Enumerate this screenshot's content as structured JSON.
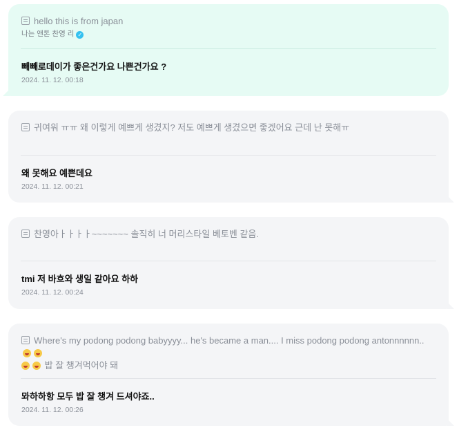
{
  "cards": [
    {
      "question": "hello this is from japan",
      "author": "나는 앤톤 찬영 리",
      "answer": "빼빼로데이가 좋은건가요 나쁜건가요 ?",
      "date": "2024. 11. 12. 00:18"
    },
    {
      "question": "귀여워 ㅠㅠ 왜 이렇게 예쁘게 생겼지? 저도 예쁘게 생겼으면 좋겠어요 근데 난 못해ㅠ",
      "answer": "왜 못해요 예쁜데요",
      "date": "2024. 11. 12. 00:21"
    },
    {
      "question": "찬영아ㅏㅏㅏㅏ~~~~~~~ 솔직히 너 머리스타일 베토벤 같음.",
      "answer": "tmi 저 바흐와 생일 같아요 하하",
      "date": "2024. 11. 12. 00:24"
    },
    {
      "question_line1": "Where's my podong podong babyyyy... he's became a man.... I miss podong podong antonnnnnn..",
      "question_line2": "밥 잘 챙겨먹어야 돼",
      "question_emojis": [
        "weary-face-emoji",
        "crying-face-emoji",
        "crying-face-emoji",
        "crying-face-emoji"
      ],
      "answer": "뫄하하항 모두 밥 잘 챙겨 드셔야죠..",
      "date": "2024. 11. 12. 00:26"
    }
  ],
  "colors": {
    "first_bubble": "#e6fbf4",
    "reply_bubble": "#f4f5f7",
    "verified_badge": "#35c1f0"
  }
}
